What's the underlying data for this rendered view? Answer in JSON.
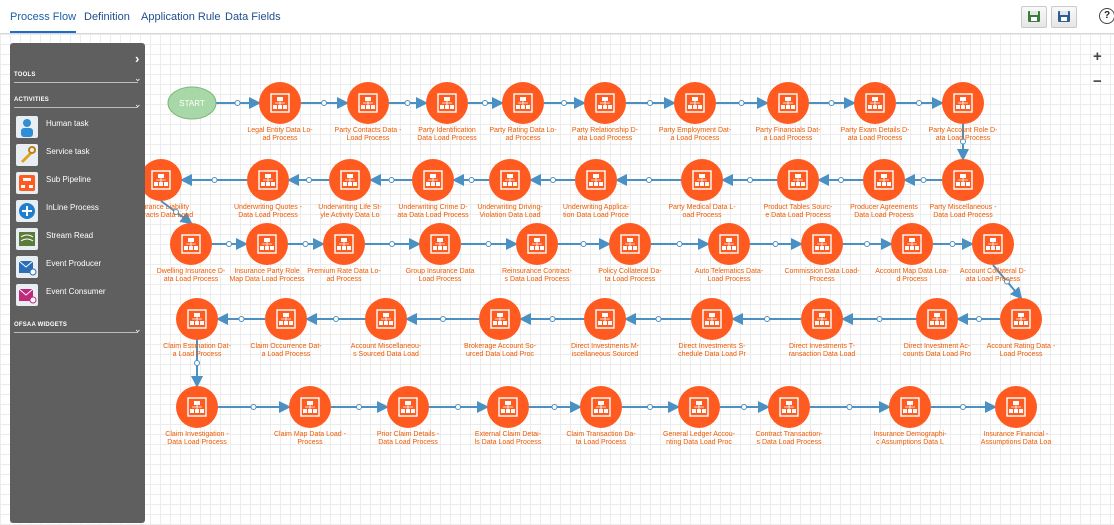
{
  "tabs": [
    {
      "label": "Process Flow",
      "active": true
    },
    {
      "label": "Definition",
      "active": false
    },
    {
      "label": "Application Rule",
      "active": false
    },
    {
      "label": "Data Fields",
      "active": false
    }
  ],
  "toolbar": {
    "save_icon": "save-icon",
    "save_as_icon": "save-as-icon",
    "help": "?"
  },
  "zoom": {
    "in": "+",
    "out": "−"
  },
  "palette": {
    "sections": {
      "tools": "TOOLS",
      "activities": "ACTIVITIES",
      "widgets": "OFSAA WIDGETS"
    },
    "items": [
      {
        "label": "Human task",
        "icon": "human-task-icon"
      },
      {
        "label": "Service task",
        "icon": "service-task-icon"
      },
      {
        "label": "Sub Pipeline",
        "icon": "sub-pipeline-icon"
      },
      {
        "label": "InLine Process",
        "icon": "inline-process-icon"
      },
      {
        "label": "Stream Read",
        "icon": "stream-read-icon"
      },
      {
        "label": "Event Producer",
        "icon": "event-producer-icon"
      },
      {
        "label": "Event Consumer",
        "icon": "event-consumer-icon"
      }
    ]
  },
  "start_label": "START",
  "colors": {
    "node": "#ff5a1f",
    "link": "#4a90c2",
    "label": "#ee5a00"
  },
  "rows": [
    [
      [
        "Legal Entity Data Lo-",
        "ad Process"
      ],
      [
        "Party Contacts Data -",
        "Load Process"
      ],
      [
        "Party Identification",
        "Data Load Process"
      ],
      [
        "Party Rating Data Lo-",
        "ad Process"
      ],
      [
        "Party Relationship D-",
        "ata Load Process"
      ],
      [
        "Party Employment Dat-",
        "a Load Process"
      ],
      [
        "Party Financials Dat-",
        "a Load Process"
      ],
      [
        "Party Exam Details D-",
        "ata Load Process"
      ],
      [
        "Party Account Role D-",
        "ata Load Process"
      ]
    ],
    [
      [
        "Party Miscellaneous -",
        "Data Load Process"
      ],
      [
        "Producer Agreements",
        "Data Load Process"
      ],
      [
        "Product Tables Sourc-",
        "e Data Load Process"
      ],
      [
        "Party Medical Data L-",
        "oad Process"
      ],
      [
        "Underwriting Applica-",
        "tion Data Load Proce"
      ],
      [
        "Underwriting Driving-",
        "Violation Data Load"
      ],
      [
        "Underwriting Crime D-",
        "ata Data Load Process"
      ],
      [
        "Underwriting Life St-",
        "yle Activity Data Lo"
      ],
      [
        "Underwriting Quotes -",
        "Data Load Process"
      ],
      [
        "Insurance Liability",
        "Contracts Data Load"
      ]
    ],
    [
      [
        "Dwelling Insurance D-",
        "ata Load Process"
      ],
      [
        "Insurance Party Role",
        "Map Data Load Process"
      ],
      [
        "Premium Rate Data Lo-",
        "ad Process"
      ],
      [
        "Group Insurance Data",
        "Load Process"
      ],
      [
        "Reinsurance Contract-",
        "s Data Load Process"
      ],
      [
        "Policy Collateral Da-",
        "ta Load Process"
      ],
      [
        "Auto Telematics Data-",
        "Load Process"
      ],
      [
        "Commission Data Load-",
        "Process"
      ],
      [
        "Account Map Data Loa-",
        "d Process"
      ],
      [
        "Account Collateral D-",
        "ata Load Process"
      ]
    ],
    [
      [
        "Account Rating Data -",
        "Load Process"
      ],
      [
        "Direct Investment Ac-",
        "counts Data Load Pro"
      ],
      [
        "Direct Investments T-",
        "ransaction Data Load"
      ],
      [
        "Direct Investments S-",
        "chedule Data Load Pr"
      ],
      [
        "Direct Investments M-",
        "iscellaneous Sourced"
      ],
      [
        "Brokerage Account So-",
        "urced Data Load Proc"
      ],
      [
        "Account Miscellaneou-",
        "s Sourced Data Load"
      ],
      [
        "Claim Occurrence Dat-",
        "a Load Process"
      ],
      [
        "Claim Estimation Dat-",
        "a Load Process"
      ]
    ],
    [
      [
        "Claim Investigation -",
        "Data Load Process"
      ],
      [
        "Claim Map Data Load -",
        "Process"
      ],
      [
        "Prior Claim Details -",
        "Data Load Process"
      ],
      [
        "External Claim Detai-",
        "ls Data Load Process"
      ],
      [
        "Claim Transaction Da-",
        "ta Load Process"
      ],
      [
        "General Ledger Accou-",
        "nting Data Load Proc"
      ],
      [
        "Contract Transaction-",
        "s Data Load Process"
      ],
      [
        "Insurance Demographi-",
        "c Assumptions Data L"
      ],
      [
        "Insurance Financial -",
        "Assumptions Data Loa"
      ]
    ]
  ]
}
